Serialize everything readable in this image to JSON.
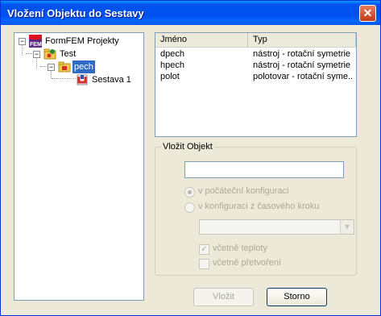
{
  "window": {
    "title": "Vložení Objektu do Sestavy"
  },
  "tree": {
    "root": {
      "label": "FormFEM Projekty",
      "expander": "−"
    },
    "test": {
      "label": "Test",
      "expander": "−"
    },
    "pech": {
      "label": "pech",
      "expander": "−"
    },
    "sestava": {
      "label": "Sestava 1"
    }
  },
  "objects_table": {
    "columns": [
      "Jméno",
      "Typ"
    ],
    "rows": [
      {
        "name": "dpech",
        "type": "nástroj - rotační symetrie"
      },
      {
        "name": "hpech",
        "type": "nástroj - rotační symetrie"
      },
      {
        "name": "polot",
        "type": "polotovar - rotační syme..."
      }
    ]
  },
  "insert_group": {
    "title": "Vložit Objekt",
    "name_value": "",
    "radio_initial": "v počáteční konfiguraci",
    "radio_timestep": "v konfiguraci z časového kroku",
    "combo_value": "",
    "check_temperature": "včetně teploty",
    "check_deformation": "včetně přetvoření"
  },
  "buttons": {
    "insert": "Vložit",
    "cancel": "Storno"
  }
}
